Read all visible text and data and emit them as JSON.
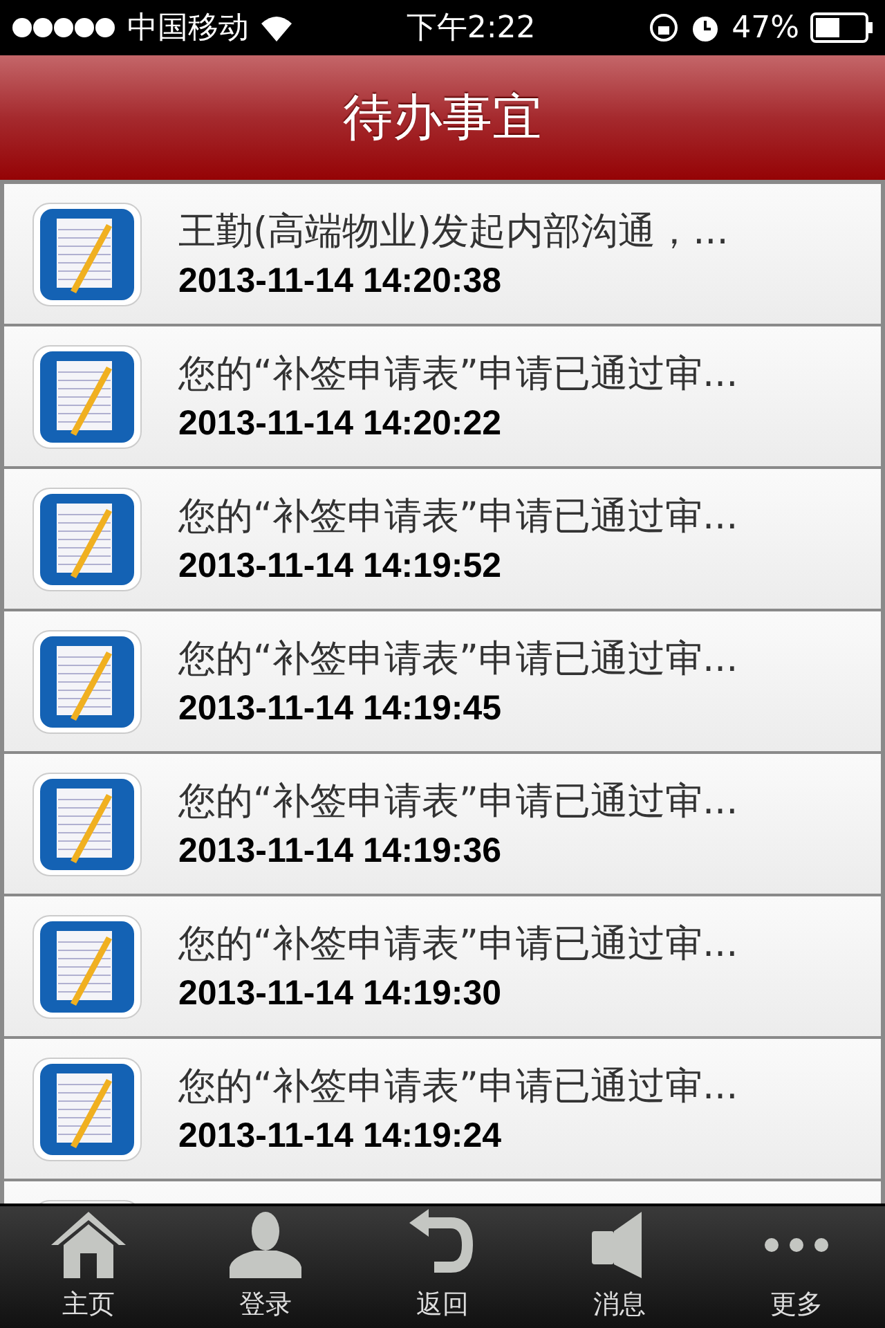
{
  "status_bar": {
    "carrier": "中国移动",
    "time": "下午2:22",
    "battery": "47%"
  },
  "header": {
    "title": "待办事宜"
  },
  "items": [
    {
      "text": "王勤(高端物业)发起内部沟通，...",
      "time": "2013-11-14 14:20:38"
    },
    {
      "text": "您的“补签申请表”申请已通过审...",
      "time": "2013-11-14 14:20:22"
    },
    {
      "text": "您的“补签申请表”申请已通过审...",
      "time": "2013-11-14 14:19:52"
    },
    {
      "text": "您的“补签申请表”申请已通过审...",
      "time": "2013-11-14 14:19:45"
    },
    {
      "text": "您的“补签申请表”申请已通过审...",
      "time": "2013-11-14 14:19:36"
    },
    {
      "text": "您的“补签申请表”申请已通过审...",
      "time": "2013-11-14 14:19:30"
    },
    {
      "text": "您的“补签申请表”申请已通过审...",
      "time": "2013-11-14 14:19:24"
    }
  ],
  "tab_bar": [
    {
      "kind": "home",
      "label": "主页"
    },
    {
      "kind": "user",
      "label": "登录"
    },
    {
      "kind": "back",
      "label": "返回"
    },
    {
      "kind": "speaker",
      "label": "消息"
    },
    {
      "kind": "more",
      "label": "更多"
    }
  ]
}
